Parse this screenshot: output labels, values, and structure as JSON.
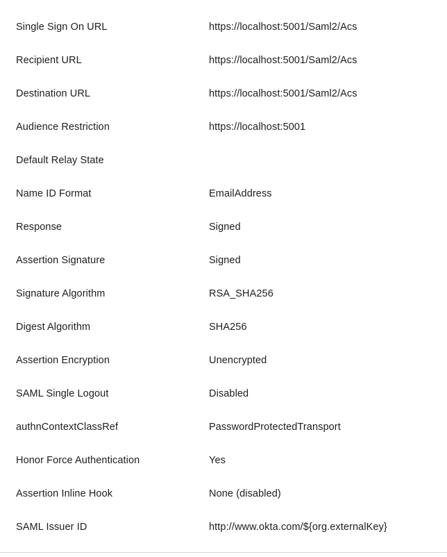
{
  "settings": [
    {
      "label": "Single Sign On URL",
      "value": "https://localhost:5001/Saml2/Acs"
    },
    {
      "label": "Recipient URL",
      "value": "https://localhost:5001/Saml2/Acs"
    },
    {
      "label": "Destination URL",
      "value": "https://localhost:5001/Saml2/Acs"
    },
    {
      "label": "Audience Restriction",
      "value": "https://localhost:5001"
    },
    {
      "label": "Default Relay State",
      "value": ""
    },
    {
      "label": "Name ID Format",
      "value": "EmailAddress"
    },
    {
      "label": "Response",
      "value": "Signed"
    },
    {
      "label": "Assertion Signature",
      "value": "Signed"
    },
    {
      "label": "Signature Algorithm",
      "value": "RSA_SHA256"
    },
    {
      "label": "Digest Algorithm",
      "value": "SHA256"
    },
    {
      "label": "Assertion Encryption",
      "value": "Unencrypted"
    },
    {
      "label": "SAML Single Logout",
      "value": "Disabled"
    },
    {
      "label": "authnContextClassRef",
      "value": "PasswordProtectedTransport"
    },
    {
      "label": "Honor Force Authentication",
      "value": "Yes"
    },
    {
      "label": "Assertion Inline Hook",
      "value": "None (disabled)"
    },
    {
      "label": "SAML Issuer ID",
      "value": "http://www.okta.com/${org.externalKey}"
    }
  ]
}
